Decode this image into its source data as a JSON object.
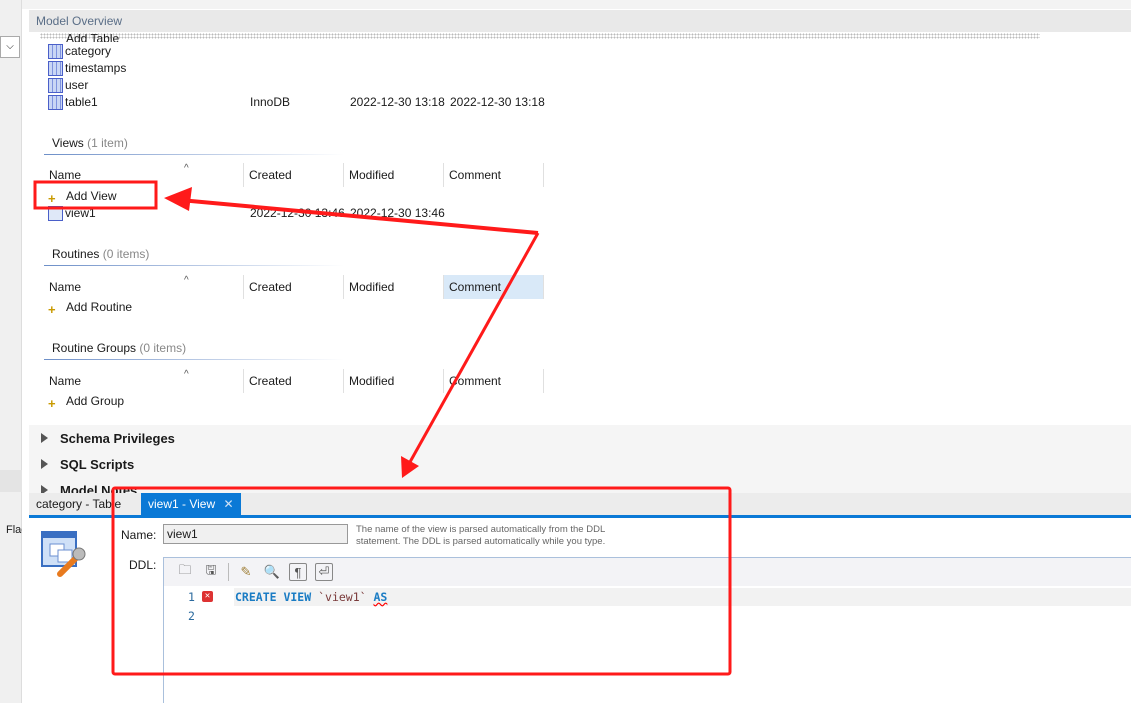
{
  "header": {
    "title": "Model Overview"
  },
  "tables": {
    "add_label": "Add Table",
    "items": [
      {
        "name": "category",
        "engine": "",
        "created": "",
        "modified": ""
      },
      {
        "name": "timestamps",
        "engine": "",
        "created": "",
        "modified": ""
      },
      {
        "name": "user",
        "engine": "",
        "created": "",
        "modified": ""
      },
      {
        "name": "table1",
        "engine": "InnoDB",
        "created": "2022-12-30 13:18",
        "modified": "2022-12-30 13:18"
      }
    ]
  },
  "columns": {
    "name": "Name",
    "created": "Created",
    "modified": "Modified",
    "comment": "Comment"
  },
  "views": {
    "title": "Views",
    "count": "(1 item)",
    "add_label": "Add View",
    "items": [
      {
        "name": "view1",
        "created": "2022-12-30 13:46",
        "modified": "2022-12-30 13:46"
      }
    ]
  },
  "routines": {
    "title": "Routines",
    "count": "(0 items)",
    "add_label": "Add Routine"
  },
  "routine_groups": {
    "title": "Routine Groups",
    "count": "(0 items)",
    "add_label": "Add Group"
  },
  "collapsed_sections": [
    "Schema Privileges",
    "SQL Scripts",
    "Model Notes"
  ],
  "tabs": [
    {
      "label": "category - Table"
    },
    {
      "label": "view1 - View",
      "active": true
    }
  ],
  "left_partial": "Flag",
  "editor": {
    "name_label": "Name:",
    "name_value": "view1",
    "hint": "The name of the view is parsed automatically from the DDL statement. The DDL is parsed automatically while you type.",
    "ddl_label": "DDL:",
    "lines": [
      {
        "num": "1",
        "kw1": "CREATE VIEW",
        "ident": " `view1` ",
        "kw2": "AS",
        "error": true
      },
      {
        "num": "2"
      }
    ]
  },
  "colors": {
    "accent": "#0a79d6",
    "annotation": "#ff1a1a",
    "keyword": "#1a7cc4"
  }
}
